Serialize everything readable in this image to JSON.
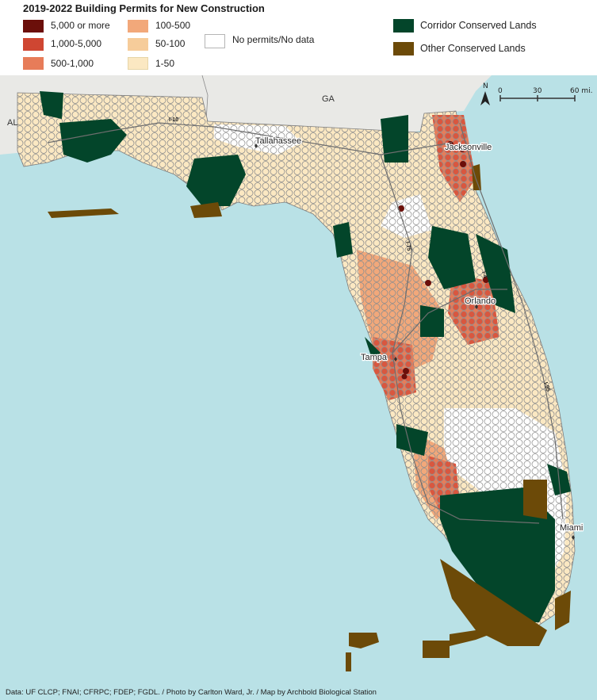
{
  "legend": {
    "title": "2019-2022 Building Permits for New Construction",
    "permit_classes": [
      {
        "label": "5,000 or more",
        "color": "#6b0f0a"
      },
      {
        "label": "1,000-5,000",
        "color": "#cf4632"
      },
      {
        "label": "500-1,000",
        "color": "#e77c59"
      },
      {
        "label": "100-500",
        "color": "#f2a87a"
      },
      {
        "label": "50-100",
        "color": "#f6cc9a"
      },
      {
        "label": "1-50",
        "color": "#fbe8c2"
      }
    ],
    "no_data": {
      "label": "No permits/No data",
      "color": "#ffffff"
    },
    "conserved": [
      {
        "label": "Corridor Conserved Lands",
        "color": "#03452a"
      },
      {
        "label": "Other Conserved Lands",
        "color": "#6c4a08"
      }
    ]
  },
  "map": {
    "colors": {
      "water": "#b9e1e6",
      "land_other": "#e9e9e6",
      "state_border": "#8a8a8a"
    },
    "states": [
      "AL",
      "GA"
    ],
    "cities": [
      {
        "name": "Tallahassee"
      },
      {
        "name": "Jacksonville"
      },
      {
        "name": "Orlando"
      },
      {
        "name": "Tampa"
      },
      {
        "name": "Miami"
      }
    ],
    "highways": [
      "I-10",
      "I-75",
      "I-4",
      "I-95"
    ],
    "north_arrow": "N",
    "scale_bar": {
      "ticks": [
        "0",
        "30",
        "60 mi."
      ]
    }
  },
  "credit": "Data: UF CLCP; FNAI; CFRPC; FDEP; FGDL. / Photo by Carlton Ward, Jr. / Map by Archbold Biological Station"
}
